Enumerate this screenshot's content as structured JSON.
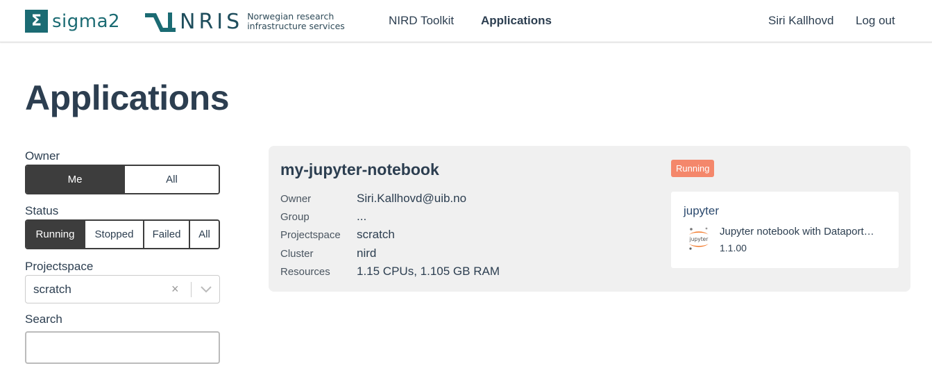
{
  "header": {
    "sigma_brand": "sigma2",
    "sigma_symbol": "Σ",
    "nris_brand": "NRIS",
    "nris_tagline_1": "Norwegian research",
    "nris_tagline_2": "infrastructure services",
    "nav": {
      "toolkit": "NIRD Toolkit",
      "applications": "Applications"
    },
    "user": "Siri Kallhovd",
    "logout": "Log out"
  },
  "page_title": "Applications",
  "filters": {
    "owner": {
      "label": "Owner",
      "options": [
        "Me",
        "All"
      ],
      "selected": "Me"
    },
    "status": {
      "label": "Status",
      "options": [
        "Running",
        "Stopped",
        "Failed",
        "All"
      ],
      "selected": "Running"
    },
    "projectspace": {
      "label": "Projectspace",
      "value": "scratch",
      "clear_icon": "×"
    },
    "search": {
      "label": "Search",
      "value": ""
    }
  },
  "application": {
    "name": "my-jupyter-notebook",
    "status": "Running",
    "status_color": "#f4876b",
    "fields": [
      {
        "label": "Owner",
        "value": "Siri.Kallhovd@uib.no"
      },
      {
        "label": "Group",
        "value": "..."
      },
      {
        "label": "Projectspace",
        "value": "scratch"
      },
      {
        "label": "Cluster",
        "value": "nird"
      },
      {
        "label": "Resources",
        "value": "1.15 CPUs, 1.105 GB RAM"
      }
    ],
    "package": {
      "name": "jupyter",
      "description": "Jupyter notebook with Dataport…",
      "version": "1.1.00",
      "logo_text": "jupyter"
    }
  },
  "colors": {
    "brand_teal": "#1b6b73",
    "text": "#2c3e50",
    "active_segment": "#3d3d3d",
    "card_bg": "#f0f0f0"
  }
}
